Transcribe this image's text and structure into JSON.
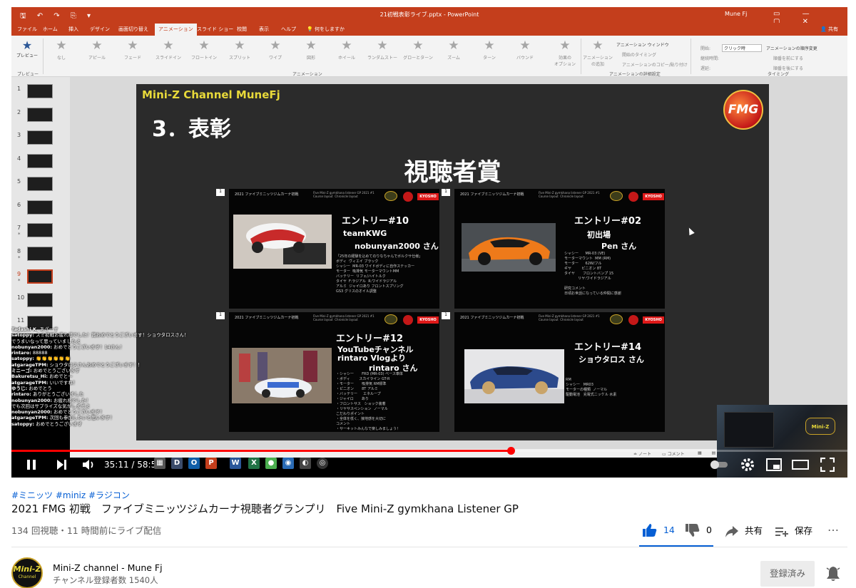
{
  "ppt": {
    "qat": "🖫 ↶ ↷ ⎘ ▾",
    "file_title": "21初戦表彰ライブ.pptx - PowerPoint",
    "user": "Mune Fj",
    "tabs": [
      "ファイル",
      "ホーム",
      "挿入",
      "デザイン",
      "画面切り替え",
      "アニメーション",
      "スライド ショー",
      "校閲",
      "表示",
      "ヘルプ",
      "何をしますか"
    ],
    "active_tab": "アニメーション",
    "share": "共有",
    "preview_label": "プレビュー",
    "preview_group": "プレビュー",
    "animations": [
      "なし",
      "アピール",
      "フェード",
      "スライドイン",
      "フロートイン",
      "スプリット",
      "ワイプ",
      "図形",
      "ホイール",
      "ランダムストー",
      "グローとターン",
      "ズーム",
      "ターン",
      "バウンド"
    ],
    "effect_options": "効果の\nオプション",
    "group_animation": "アニメーション",
    "add_animation": "アニメーション\nの追加",
    "anim_window": "アニメーション ウィンドウ",
    "trigger": "開始のタイミング",
    "painter": "アニメーションのコピー/貼り付け",
    "group_advanced": "アニメーションの詳細設定",
    "start_label": "開始:",
    "start_value": "クリック時",
    "duration_label": "継続時間:",
    "delay_label": "遅延:",
    "reorder_title": "アニメーションの順序変更",
    "move_earlier": "順番を前にする",
    "move_later": "順番を後にする",
    "group_timing": "タイミング",
    "thumbs": [
      {
        "n": "1",
        "star": ""
      },
      {
        "n": "2",
        "star": ""
      },
      {
        "n": "3",
        "star": ""
      },
      {
        "n": "4",
        "star": ""
      },
      {
        "n": "5",
        "star": ""
      },
      {
        "n": "6",
        "star": ""
      },
      {
        "n": "7",
        "star": "*"
      },
      {
        "n": "8",
        "star": "*"
      },
      {
        "n": "9",
        "star": "*"
      },
      {
        "n": "10",
        "star": ""
      },
      {
        "n": "11",
        "star": ""
      }
    ],
    "selected_thumb": 8,
    "status_note": "ノート",
    "status_comment": "コメント"
  },
  "slide": {
    "channel": "Mini-Z Channel MuneFj",
    "heading": "3．表彰",
    "award": "視聴者賞",
    "logo": "FMG",
    "card_header": "2021 ファイブミニッツジムカーナ初戦",
    "card_header2": "Five Mini-Z gymkhana listener GP 2021 #1\nCourse layout  Chronicle layout",
    "kyosho": "KYOSHO",
    "entries": [
      {
        "num": "1",
        "title": "エントリー#10",
        "lines": [
          "teamKWG",
          "nobunyan2000 さん"
        ],
        "specs": "「25年の経験を込めてのりなちゃんでボルクサ仕様」\nボディ  ヴィエイ ブラック\nシャシー  MR-03 ワイドボディに自作ステッカー\nモーター  吸排気 モーターマウントMM\nバッテリー  リフェ/ハイトルク\nタイヤ  F:ラジアル  R:ワイドラジアル\nアルミ  ジャイロあり フロントスプリング\nGS3 グリスのオイル調整"
      },
      {
        "num": "1",
        "title": "エントリー#02",
        "lines": [
          "初出場",
          "Pen さん"
        ],
        "specs": "シャシー      MR-03 (VE)\nモーターマウント  MM (RM)\nモーター      62W/フル\nギヤ         ピニオン 8T\nタイヤ       フロントバンプ 15\n            リヤ:ワイドラジアル\n\n研究コメント\n日頃お世話になっている仲間に感謝"
      },
      {
        "num": "1",
        "title": "エントリー#12",
        "lines": [
          "YouTubeチャンネル",
          "rintaro Vlogより",
          "rintaro さん"
        ],
        "specs": "・シャシー       FRD (MR-03) ベース車体\n・ボディ        スカイライン GT-R\n・モーター       吸排気 RM標準\n・ピニオン       8T アルミ\n・バッテリー     エネループ\n・ジャイロ       あり\n・フロントサス   ショック装着\n・リヤサスペンション  ノーマル\nこだわりポイント\n・全体を低く、接地感を大切に\nコメント\n・サーキットみんなで楽しみましょう！"
      },
      {
        "num": "1",
        "title": "エントリー#14",
        "lines": [
          "ショウタロス さん"
        ],
        "specs": "RM\nシャシー   MR03\nモーターの種類  ノーマル\n駆動電池   充電式ニッケル 水素"
      }
    ]
  },
  "chat": [
    {
      "user": "Tadashi K.",
      "msg": "あざーす"
    },
    {
      "user": "satoppy:",
      "msg": "スミ初戦お疲れ様でした！賞おめでとうございます！ショウタロスさん！"
    },
    {
      "user": "",
      "msg": "でうまいなって思っていましたよ"
    },
    {
      "user": "nobunyan2000:",
      "msg": "おめでとうございます！14さん！"
    },
    {
      "user": "rintaro:",
      "msg": "88888"
    },
    {
      "user": "satoppy:",
      "msg": "👏👏👏👏👏👏"
    },
    {
      "user": "atgarageTPM:",
      "msg": "ショウタロスさんおめでとうございます！！"
    },
    {
      "user": "ミニーゴ:",
      "msg": "おめでとうございます"
    },
    {
      "user": "Bakuretsu_Hi:",
      "msg": "おめでと〜"
    },
    {
      "user": "atgarageTPM:",
      "msg": "いいですね！"
    },
    {
      "user": "ゆうじ:",
      "msg": "おめでとう"
    },
    {
      "user": "rintaro:",
      "msg": "ありがとうございました"
    },
    {
      "user": "nobunyan2000:",
      "msg": "お疲れ様でした！"
    },
    {
      "user": "",
      "msg": "でも次回はサプライズな気がしますよ"
    },
    {
      "user": "nobunyan2000:",
      "msg": "おめでとうございます！"
    },
    {
      "user": "atgarageTPM:",
      "msg": "次回も参加したいと思います！"
    },
    {
      "user": "satoppy:",
      "msg": "おめでとうございます"
    }
  ],
  "webcam_badge": "Mini-Z",
  "player": {
    "current_time": "35:11",
    "duration": "58:56",
    "time_sep": " / ",
    "progress_fraction": 0.597
  },
  "video": {
    "hashtags": "#ミニッツ #miniz #ラジコン",
    "title": "2021 FMG 初戦　ファイブミニッツジムカーナ視聴者グランプリ　Five Mini-Z gymkhana Listener GP",
    "views": "134 回視聴・11 時間前にライブ配信",
    "likes": "14",
    "dislikes": "0",
    "share": "共有",
    "save": "保存",
    "more": "…"
  },
  "channel": {
    "name": "Mini-Z channel - Mune Fj",
    "subscribers": "チャンネル登録者数 1540人",
    "avatar_text": "Mini-Z",
    "avatar_sub": "Channel",
    "subscribed": "登録済み"
  },
  "colors": {
    "ppt_red": "#c43e1c",
    "yt_red": "#ff0000",
    "link_blue": "#065fd4"
  }
}
